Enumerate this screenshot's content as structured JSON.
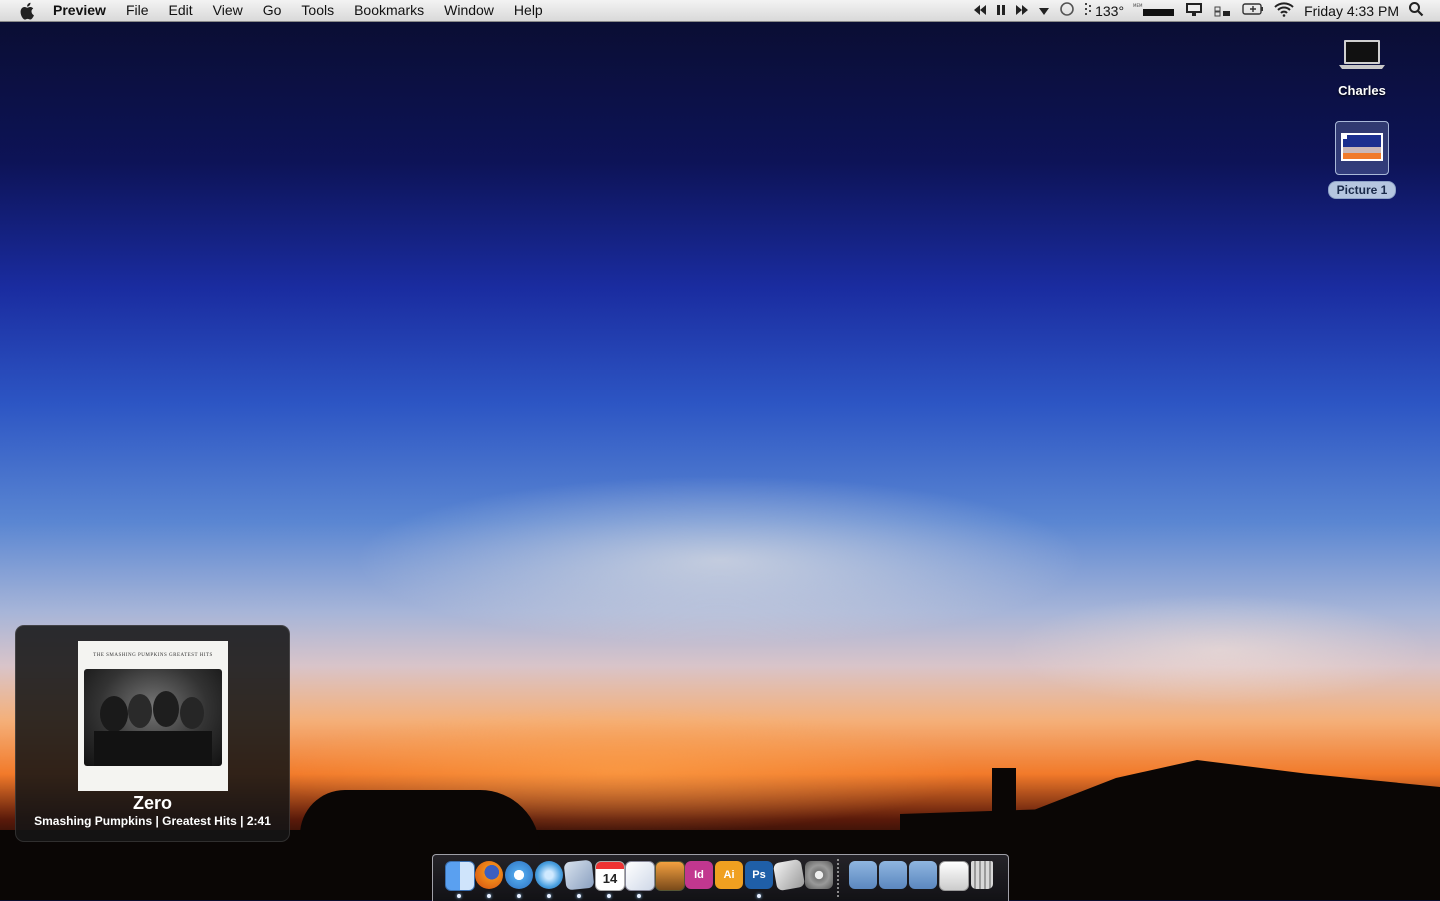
{
  "menubar": {
    "app_name": "Preview",
    "items": [
      "File",
      "Edit",
      "View",
      "Go",
      "Tools",
      "Bookmarks",
      "Window",
      "Help"
    ],
    "status": {
      "temperature": "133°",
      "clock": "Friday 4:33 PM"
    }
  },
  "desktop": {
    "icons": [
      {
        "label": "Charles"
      },
      {
        "label": "Picture 1"
      }
    ]
  },
  "now_playing": {
    "album_header": "THE SMASHING PUMPKINS GREATEST HITS",
    "title": "Zero",
    "subtitle": "Smashing Pumpkins | Greatest Hits | 2:41"
  },
  "dock": {
    "calendar_date": "14",
    "indesign_label": "Id",
    "illustrator_label": "Ai",
    "photoshop_label": "Ps"
  }
}
